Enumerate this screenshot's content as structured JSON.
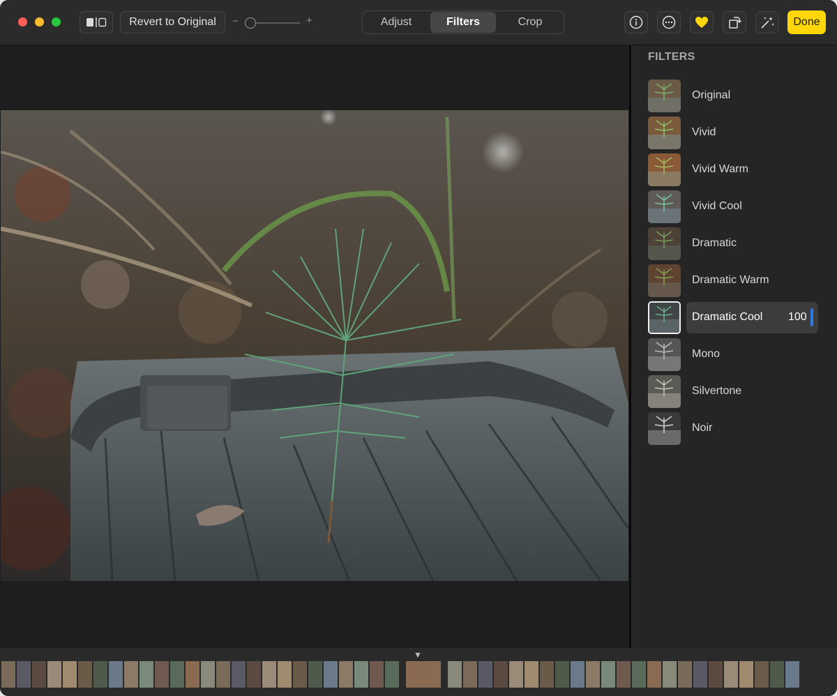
{
  "toolbar": {
    "revert_label": "Revert to Original",
    "slider_minus": "−",
    "slider_plus": "+",
    "slider_value": 0,
    "tabs": [
      {
        "label": "Adjust",
        "active": false
      },
      {
        "label": "Filters",
        "active": true
      },
      {
        "label": "Crop",
        "active": false
      }
    ],
    "done_label": "Done",
    "accent": "#ffd60a"
  },
  "sidebar": {
    "title": "FILTERS",
    "filters": [
      {
        "label": "Original",
        "selected": false
      },
      {
        "label": "Vivid",
        "selected": false
      },
      {
        "label": "Vivid Warm",
        "selected": false
      },
      {
        "label": "Vivid Cool",
        "selected": false
      },
      {
        "label": "Dramatic",
        "selected": false
      },
      {
        "label": "Dramatic Warm",
        "selected": false
      },
      {
        "label": "Dramatic Cool",
        "selected": true,
        "value": "100"
      },
      {
        "label": "Mono",
        "selected": false
      },
      {
        "label": "Silvertone",
        "selected": false
      },
      {
        "label": "Noir",
        "selected": false
      }
    ],
    "selection_color": "#2b7be6"
  },
  "filmstrip": {
    "arrow": "▼"
  }
}
